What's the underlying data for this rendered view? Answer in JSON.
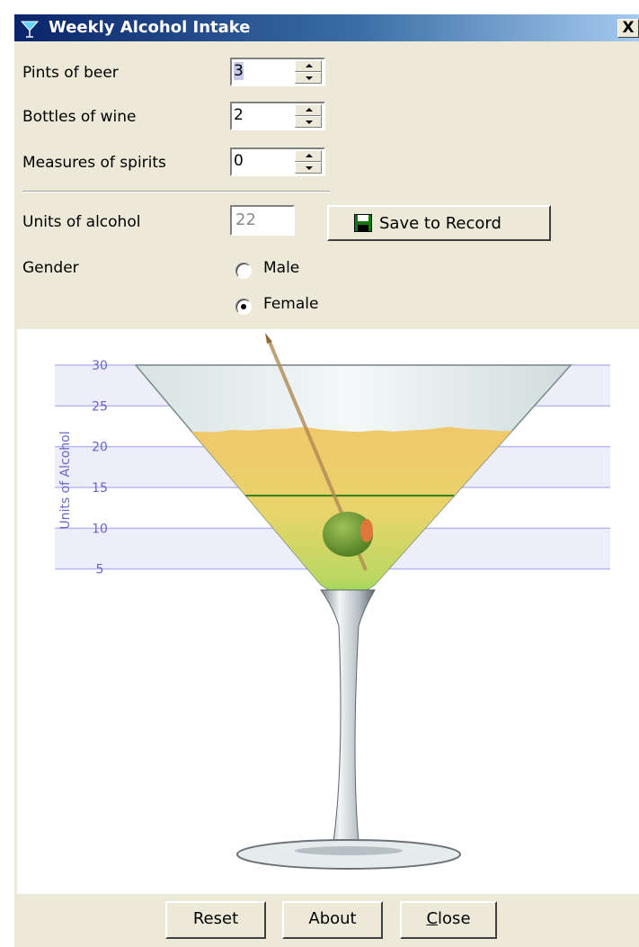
{
  "window": {
    "title": "Weekly Alcohol Intake",
    "close_glyph": "X",
    "icon": "martini-icon"
  },
  "inputs": {
    "beer": {
      "label": "Pints of beer",
      "value": "3"
    },
    "wine": {
      "label": "Bottles of wine",
      "value": "2"
    },
    "spirits": {
      "label": "Measures of spirits",
      "value": "0"
    }
  },
  "units": {
    "label": "Units of alcohol",
    "value": "22"
  },
  "save_button": {
    "label": "Save to Record",
    "icon": "floppy-disk-icon"
  },
  "gender": {
    "label": "Gender",
    "options": [
      {
        "label": "Male",
        "selected": false
      },
      {
        "label": "Female",
        "selected": true
      }
    ]
  },
  "chart": {
    "axis_label": "Units of Alcohol",
    "ticks": [
      "30",
      "25",
      "20",
      "15",
      "10",
      "5"
    ],
    "fill_level": 22,
    "limit_line": 14
  },
  "chart_data": {
    "type": "area",
    "ylabel": "Units of Alcohol",
    "ylim": [
      0,
      30
    ],
    "yticks": [
      5,
      10,
      15,
      20,
      25,
      30
    ],
    "values": [
      22
    ],
    "reference_lines": [
      14
    ]
  },
  "buttons": {
    "reset": "Reset",
    "about": "About",
    "close": "Close"
  },
  "colors": {
    "titlebar": "#0a246a",
    "band": "#eeeefa",
    "gridline": "#b8b8f0",
    "tick_text": "#6666cc",
    "limit_line": "#2e7d1e",
    "liquid_top": "#f1c86b",
    "liquid_bottom": "#5fdc55"
  }
}
